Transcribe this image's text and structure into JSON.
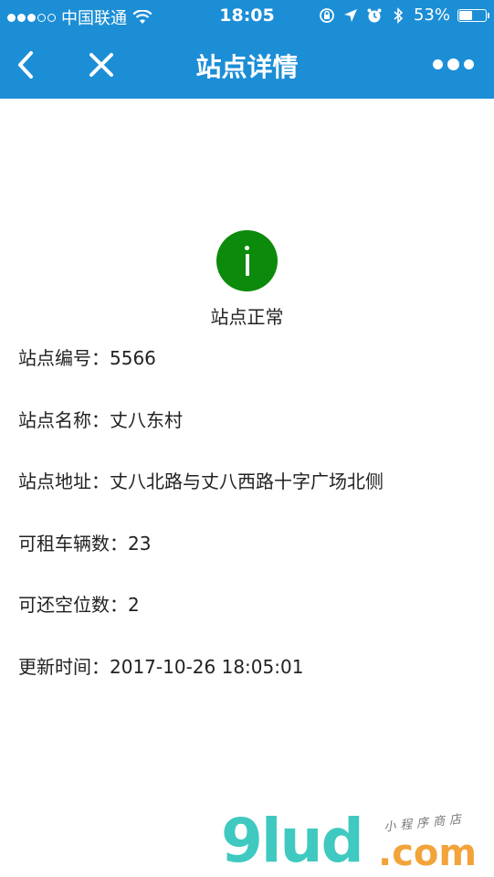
{
  "status_bar": {
    "carrier": "中国联通",
    "time": "18:05",
    "battery_pct": "53%",
    "battery_level": 0.53,
    "signal_bars_filled": 3,
    "signal_bars_total": 5,
    "icons": [
      "wifi-icon",
      "rotation-lock-icon",
      "location-arrow-icon",
      "alarm-icon",
      "bluetooth-icon",
      "battery-icon"
    ]
  },
  "nav": {
    "title": "站点详情",
    "back_icon": "chevron-left-icon",
    "close_icon": "close-icon",
    "more_icon": "more-dots-icon"
  },
  "status": {
    "icon": "info-icon",
    "text": "站点正常",
    "color": "#0b8a0b"
  },
  "details": [
    {
      "label": "站点编号：",
      "value": "5566"
    },
    {
      "label": "站点名称：",
      "value": "丈八东村"
    },
    {
      "label": "站点地址：",
      "value": "丈八北路与丈八西路十字广场北侧"
    },
    {
      "label": "可租车辆数：",
      "value": "23"
    },
    {
      "label": "可还空位数：",
      "value": "2"
    },
    {
      "label": "更新时间：",
      "value": "2017-10-26 18:05:01"
    }
  ],
  "watermark": {
    "main": "9lud",
    "com": ".com",
    "tagline": "小程序商店"
  },
  "colors": {
    "nav_bg": "#1c8ed6",
    "text": "#222222",
    "watermark_main": "#3fc9c0",
    "watermark_com": "#f2a33a"
  }
}
